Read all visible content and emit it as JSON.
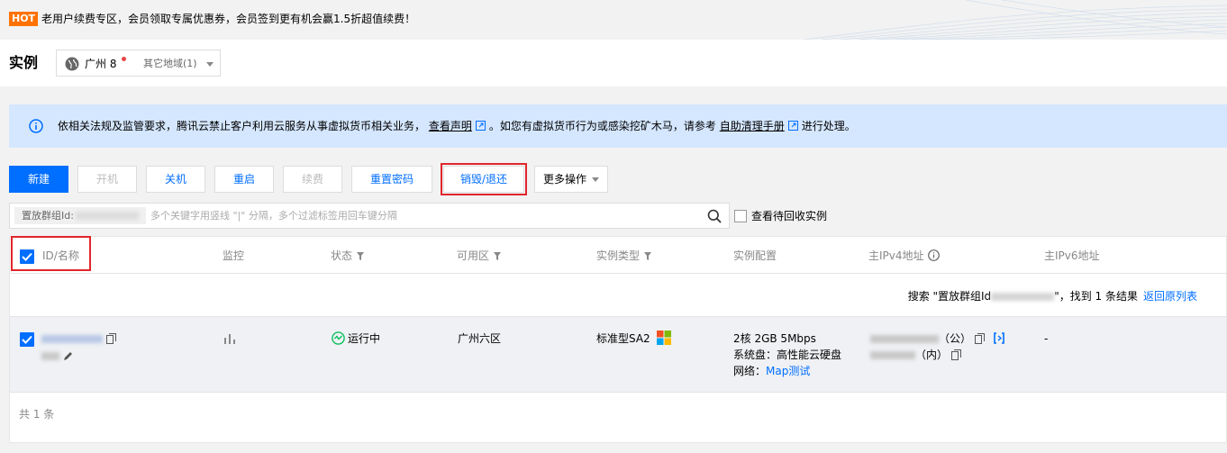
{
  "promo": {
    "badge": "HOT",
    "text": "老用户续费专区，会员领取专属优惠券，会员签到更有机会赢1.5折超值续费！"
  },
  "header": {
    "title": "实例",
    "region": "广州 8",
    "other_regions": "其它地域(1)"
  },
  "notice": {
    "part1": "依相关法规及监管要求，腾讯云禁止客户利用云服务从事虚拟货币相关业务，",
    "link1": "查看声明",
    "part2": "。如您有虚拟货币行为或感染挖矿木马，请参考",
    "link2": "自助清理手册",
    "part3": "进行处理。"
  },
  "toolbar": {
    "create": "新建",
    "start": "开机",
    "shutdown": "关机",
    "restart": "重启",
    "renew": "续费",
    "reset_password": "重置密码",
    "destroy": "销毁/退还",
    "more": "更多操作"
  },
  "search": {
    "tag_label": "置放群组Id:",
    "placeholder": "多个关键字用竖线 \"|\" 分隔，多个过滤标签用回车键分隔",
    "recycle_label": "查看待回收实例"
  },
  "table": {
    "columns": {
      "id_name": "ID/名称",
      "monitor": "监控",
      "status": "状态",
      "zone": "可用区",
      "instance_type": "实例类型",
      "config": "实例配置",
      "ipv4": "主IPv4地址",
      "ipv6": "主IPv6地址"
    },
    "result": {
      "prefix": "搜索 \"置放群组Id",
      "suffix": "\"，找到 1 条结果",
      "back_link": "返回原列表"
    },
    "row": {
      "status": "运行中",
      "zone": "广州六区",
      "instance_type": "标准型SA2",
      "config_line1": "2核 2GB 5Mbps",
      "config_line2": "系统盘：高性能云硬盘",
      "network_label": "网络：",
      "network_link": "Map测试",
      "ipv4_public_suffix": "（公）",
      "ipv4_private_suffix": "（内）",
      "ipv6": "-"
    },
    "total": "共 1 条"
  },
  "colors": {
    "primary": "#006eff",
    "hot": "#ff7200",
    "highlight": "#e1262d",
    "running": "#0abf5b",
    "notice_bg": "#d5e7ff"
  }
}
